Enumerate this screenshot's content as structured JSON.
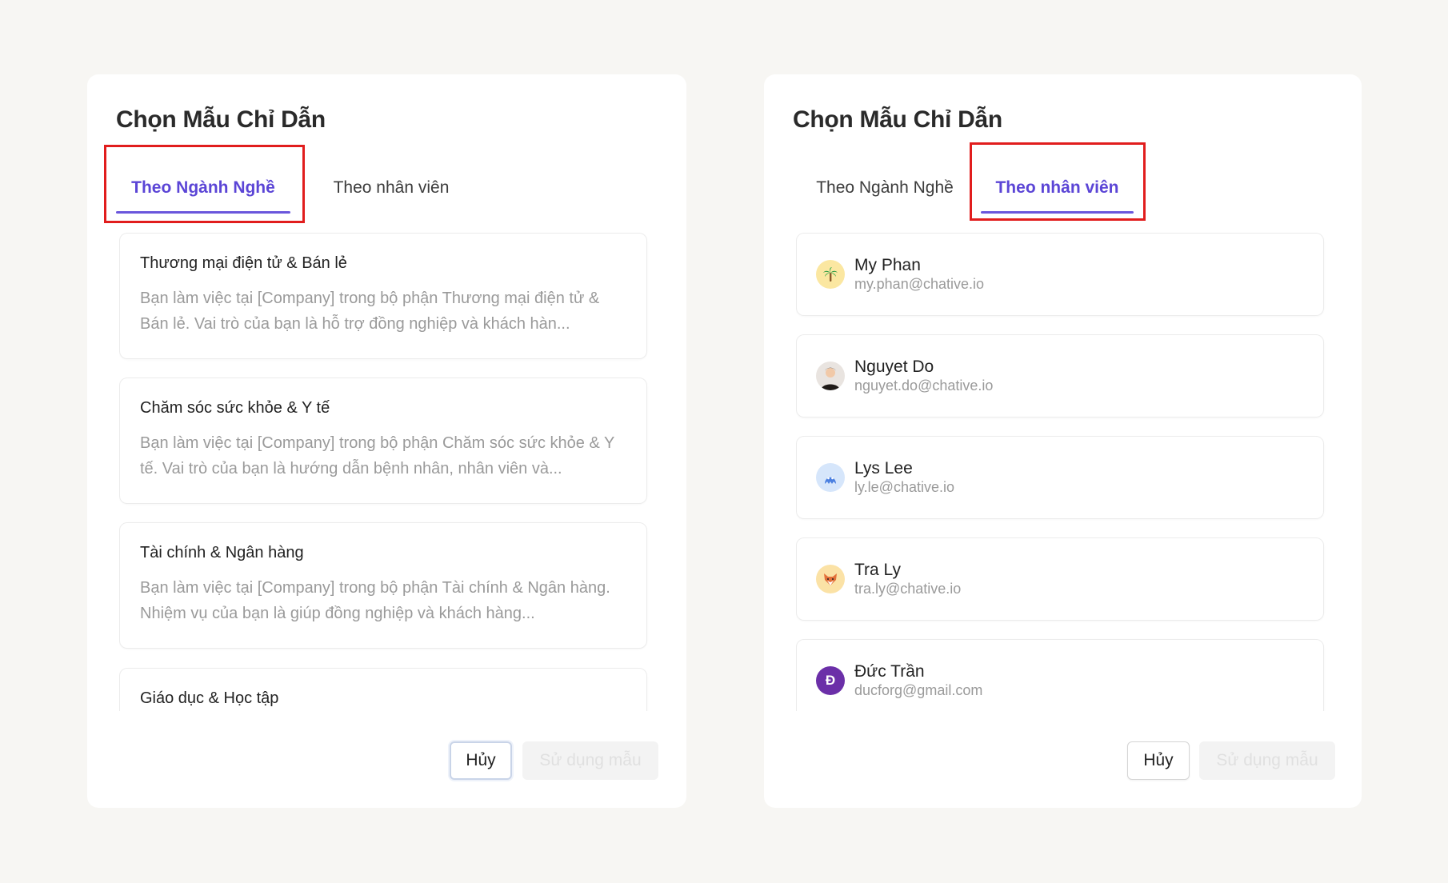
{
  "left_dialog": {
    "title": "Chọn Mẫu Chỉ Dẫn",
    "tabs": [
      {
        "label": "Theo Ngành Nghề",
        "active": true
      },
      {
        "label": "Theo nhân viên",
        "active": false
      }
    ],
    "industries": [
      {
        "title": "Thương mại điện tử & Bán lẻ",
        "description": "Bạn làm việc tại [Company] trong bộ phận Thương mại điện tử & Bán lẻ. Vai trò của bạn là hỗ trợ đồng nghiệp và khách hàn..."
      },
      {
        "title": "Chăm sóc sức khỏe & Y tế",
        "description": "Bạn làm việc tại [Company] trong bộ phận Chăm sóc sức khỏe & Y tế. Vai trò của bạn là hướng dẫn bệnh nhân, nhân viên và..."
      },
      {
        "title": "Tài chính & Ngân hàng",
        "description": "Bạn làm việc tại [Company] trong bộ phận Tài chính & Ngân hàng. Nhiệm vụ của bạn là giúp đồng nghiệp và khách hàng..."
      },
      {
        "title": "Giáo dục & Học tập",
        "description": ""
      }
    ],
    "cancel_label": "Hủy",
    "use_label": "Sử dụng mẫu"
  },
  "right_dialog": {
    "title": "Chọn Mẫu Chỉ Dẫn",
    "tabs": [
      {
        "label": "Theo Ngành Nghề",
        "active": false
      },
      {
        "label": "Theo nhân viên",
        "active": true
      }
    ],
    "staff": [
      {
        "name": "My Phan",
        "email": "my.phan@chative.io",
        "avatar_icon": "palm-tree-icon",
        "avatar_bg": "#fbe7a1"
      },
      {
        "name": "Nguyet Do",
        "email": "nguyet.do@chative.io",
        "avatar_icon": "person-photo-icon",
        "avatar_bg": "#e9e4e0"
      },
      {
        "name": "Lys Lee",
        "email": "ly.le@chative.io",
        "avatar_icon": "blue-monster-icon",
        "avatar_bg": "#d6e6fb"
      },
      {
        "name": "Tra Ly",
        "email": "tra.ly@chative.io",
        "avatar_icon": "fox-icon",
        "avatar_bg": "#fbe2a6"
      },
      {
        "name": "Đức Trần",
        "email": "ducforg@gmail.com",
        "avatar_icon": "letter-d-icon",
        "avatar_bg": "#6b2fa8",
        "avatar_letter": "Đ"
      }
    ],
    "cancel_label": "Hủy",
    "use_label": "Sử dụng mẫu"
  },
  "colors": {
    "accent": "#5b45d6",
    "highlight": "#e11d1d",
    "page_bg": "#f7f6f3"
  }
}
